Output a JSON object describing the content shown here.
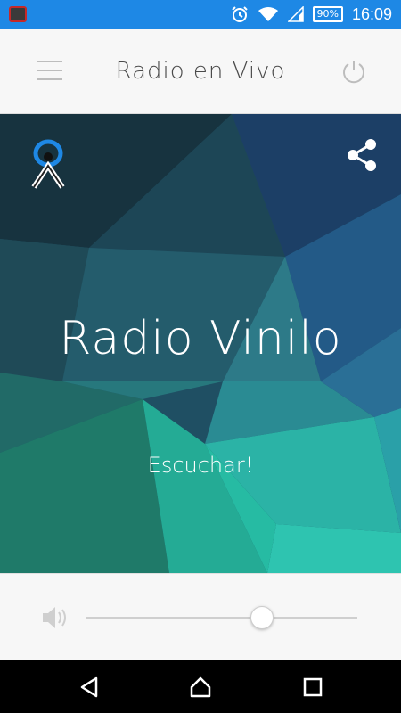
{
  "statusbar": {
    "battery": "90%",
    "time": "16:09",
    "icons": [
      "app-notification-icon",
      "alarm-icon",
      "wifi-icon",
      "signal-icon",
      "battery-icon"
    ]
  },
  "appbar": {
    "title": "Radio en Vivo",
    "icons": [
      "menu-icon",
      "power-icon"
    ]
  },
  "hero": {
    "station_name": "Radio Vinilo",
    "listen_label": "Escuchar!",
    "icons": [
      "station-logo-icon",
      "share-icon"
    ]
  },
  "controls": {
    "volume_level": 0.65,
    "icons": [
      "volume-icon"
    ]
  },
  "navbar": {
    "icons": [
      "back-icon",
      "home-icon",
      "recents-icon"
    ]
  },
  "colors": {
    "statusbar": "#1e88e5",
    "appbar": "#f7f7f7",
    "hero_dark": "#1b3a4b",
    "hero_teal": "#2ec4b0",
    "text_light": "#ffffff"
  }
}
